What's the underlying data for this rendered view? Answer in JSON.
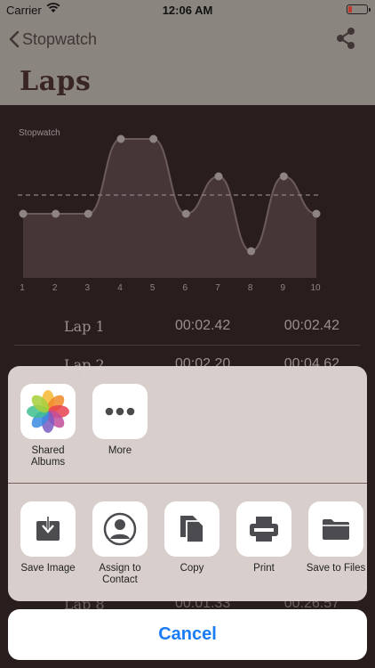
{
  "status_bar": {
    "carrier": "Carrier",
    "time": "12:06 AM"
  },
  "nav": {
    "back_label": "Stopwatch",
    "title": "Laps"
  },
  "chart_data": {
    "type": "area",
    "title": "Stopwatch",
    "x": [
      1,
      2,
      3,
      4,
      5,
      6,
      7,
      8,
      9,
      10
    ],
    "values": [
      1,
      1,
      1,
      3,
      3,
      1,
      2,
      0,
      2,
      1
    ],
    "average": 1.5,
    "ylim": [
      0,
      3
    ],
    "xlabel": "",
    "ylabel": "",
    "grid": false,
    "colors": {
      "fill": "#4a3a3b",
      "line": "#6b5b5b",
      "point": "#8f8484",
      "average": "#8f8484"
    }
  },
  "laps": [
    {
      "name": "Lap 1",
      "lap_time": "00:02.42",
      "total": "00:02.42"
    },
    {
      "name": "Lap 2",
      "lap_time": "00:02.20",
      "total": "00:04.62"
    }
  ],
  "laps_bottom": {
    "name": "Lap 8",
    "lap_time": "00:01.33",
    "total": "00:26.57"
  },
  "share_sheet": {
    "apps": [
      {
        "label": "Shared Albums",
        "icon": "photos-icon"
      },
      {
        "label": "More",
        "icon": "more-dots-icon"
      }
    ],
    "actions": [
      {
        "label": "Save Image",
        "icon": "save-image-icon"
      },
      {
        "label": "Assign to Contact",
        "icon": "contact-icon"
      },
      {
        "label": "Copy",
        "icon": "copy-icon"
      },
      {
        "label": "Print",
        "icon": "print-icon"
      },
      {
        "label": "Save to Files",
        "icon": "folder-icon"
      }
    ],
    "cancel_label": "Cancel",
    "accent": "#1a7cf5"
  }
}
